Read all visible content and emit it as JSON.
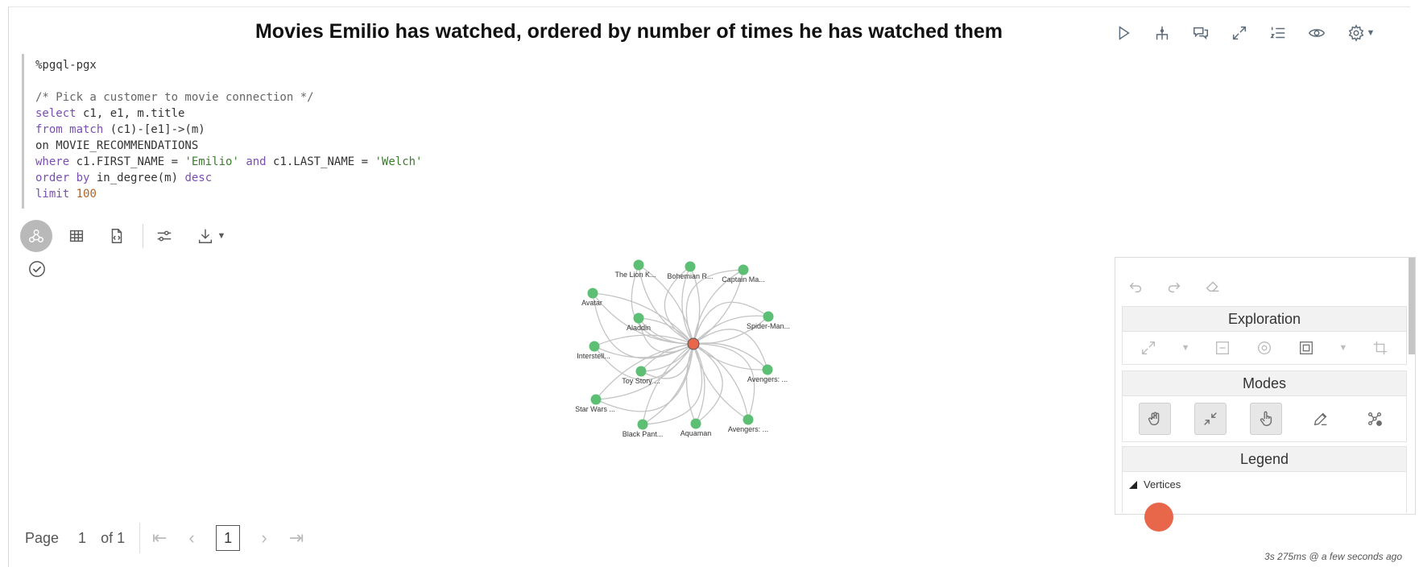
{
  "title": "Movies Emilio has watched, ordered by number of times he has watched them",
  "toolbar_icons": [
    "run-icon",
    "graph-structure-icon",
    "comments-icon",
    "expand-icon",
    "list-numbered-icon",
    "eye-icon",
    "gear-icon"
  ],
  "code": {
    "line1": "%pgql-pgx",
    "line2": "/* Pick a customer to movie connection */",
    "line3_kw": "select",
    "line3_rest": " c1, e1, m.title",
    "line4_kw": "from match",
    "line4_rest": " (c1)-[e1]->(m)",
    "line5": "on MOVIE_RECOMMENDATIONS",
    "line6_kw": "where",
    "line6_a": " c1.FIRST_NAME = ",
    "line6_s1": "'Emilio'",
    "line6_and": " and ",
    "line6_b": "c1.LAST_NAME = ",
    "line6_s2": "'Welch'",
    "line7_kw": "order by",
    "line7_a": " in_degree(m) ",
    "line7_desc": "desc",
    "line8_kw": "limit",
    "line8_num": " 100"
  },
  "graph": {
    "center_color": "#e8664a",
    "node_color": "#5cbf74",
    "nodes": [
      {
        "label": "The Lion K..."
      },
      {
        "label": "Bohemian R..."
      },
      {
        "label": "Captain Ma..."
      },
      {
        "label": "Avatar"
      },
      {
        "label": "Aladdin"
      },
      {
        "label": "Spider-Man..."
      },
      {
        "label": "Interstell..."
      },
      {
        "label": "Avengers: ..."
      },
      {
        "label": "Toy Story ..."
      },
      {
        "label": "Star Wars ..."
      },
      {
        "label": "Avengers: ..."
      },
      {
        "label": "Black Pant..."
      },
      {
        "label": "Aquaman"
      }
    ]
  },
  "side_panel": {
    "exploration": "Exploration",
    "modes": "Modes",
    "legend": "Legend",
    "vertices": "Vertices"
  },
  "pager": {
    "page_label": "Page",
    "page_value": "1",
    "of_label": "of 1",
    "current": "1"
  },
  "footer": "3s 275ms @ a few seconds ago"
}
